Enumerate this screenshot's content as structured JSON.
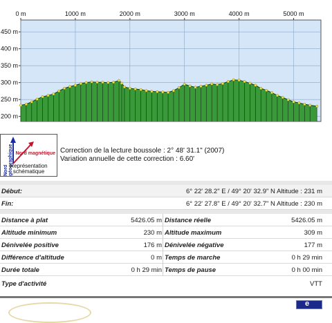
{
  "chart_data": {
    "type": "area",
    "x_unit": "m",
    "y_unit": "m",
    "xlim": [
      0,
      5500
    ],
    "ylim": [
      185,
      485
    ],
    "x_ticks": [
      "0 m",
      "1000 m",
      "2000 m",
      "3000 m",
      "4000 m",
      "5000 m"
    ],
    "x_tick_values": [
      0,
      1000,
      2000,
      3000,
      4000,
      5000
    ],
    "y_ticks": [
      "200 m",
      "250 m",
      "300 m",
      "350 m",
      "400 m",
      "450 m"
    ],
    "y_tick_values": [
      200,
      250,
      300,
      350,
      400,
      450
    ],
    "grid": true,
    "colors": {
      "plot_bg": "#d4e6f8",
      "area": "#3a9a3a",
      "area_line": "#0f3d0f",
      "marker": "#f2e24a"
    },
    "series": [
      {
        "values": [
          [
            0,
            233
          ],
          [
            100,
            236
          ],
          [
            200,
            243
          ],
          [
            300,
            251
          ],
          [
            400,
            258
          ],
          [
            500,
            262
          ],
          [
            600,
            266
          ],
          [
            700,
            275
          ],
          [
            800,
            283
          ],
          [
            900,
            288
          ],
          [
            1000,
            292
          ],
          [
            1100,
            297
          ],
          [
            1200,
            300
          ],
          [
            1300,
            302
          ],
          [
            1400,
            301
          ],
          [
            1500,
            301
          ],
          [
            1600,
            300
          ],
          [
            1700,
            301
          ],
          [
            1800,
            306
          ],
          [
            1850,
            298
          ],
          [
            1900,
            287
          ],
          [
            2000,
            283
          ],
          [
            2100,
            281
          ],
          [
            2200,
            279
          ],
          [
            2300,
            276
          ],
          [
            2400,
            274
          ],
          [
            2500,
            273
          ],
          [
            2600,
            272
          ],
          [
            2700,
            271
          ],
          [
            2800,
            276
          ],
          [
            2900,
            285
          ],
          [
            3000,
            295
          ],
          [
            3100,
            290
          ],
          [
            3200,
            286
          ],
          [
            3300,
            289
          ],
          [
            3400,
            292
          ],
          [
            3500,
            296
          ],
          [
            3600,
            294
          ],
          [
            3700,
            297
          ],
          [
            3800,
            303
          ],
          [
            3900,
            308
          ],
          [
            4000,
            307
          ],
          [
            4100,
            303
          ],
          [
            4200,
            298
          ],
          [
            4300,
            292
          ],
          [
            4400,
            283
          ],
          [
            4500,
            277
          ],
          [
            4600,
            270
          ],
          [
            4700,
            262
          ],
          [
            4800,
            256
          ],
          [
            4900,
            249
          ],
          [
            5000,
            243
          ],
          [
            5100,
            240
          ],
          [
            5200,
            236
          ],
          [
            5300,
            233
          ],
          [
            5426,
            230
          ]
        ]
      }
    ]
  },
  "compass": {
    "north_label": "Nord géographique",
    "magnetic_label": "Nord magnétique",
    "caption": "Représentation schématique",
    "line1": "Correction de la lecture boussole : 2° 48' 31.1\" (2007)",
    "line2": "Variation annuelle de cette correction : 6.60'"
  },
  "route": {
    "start_label": "Début:",
    "start_value": "6° 22' 28.2\" E / 49° 20' 32.9\" N Altitude : 231 m",
    "end_label": "Fin:",
    "end_value": "6° 22' 27.8\" E / 49° 20' 32.7\" N Altitude : 230 m"
  },
  "stats": [
    {
      "left_label": "Distance à plat",
      "left_value": "5426.05 m",
      "right_label": "Distance réelle",
      "right_value": "5426.05 m"
    },
    {
      "left_label": "Altitude minimum",
      "left_value": "230 m",
      "right_label": "Altitude maximum",
      "right_value": "309 m"
    },
    {
      "left_label": "Dénivelée positive",
      "left_value": "176 m",
      "right_label": "Dénivelée négative",
      "right_value": "177 m"
    },
    {
      "left_label": "Différence d'altitude",
      "left_value": "0 m",
      "right_label": "Temps de marche",
      "right_value": "0 h 29 min"
    },
    {
      "left_label": "Durée totale",
      "left_value": "0 h 29 min",
      "right_label": "Temps de pause",
      "right_value": "0 h 00 min"
    }
  ],
  "activity": {
    "label": "Type d'activité",
    "value": "VTT"
  },
  "footer": {
    "badge": "e"
  }
}
